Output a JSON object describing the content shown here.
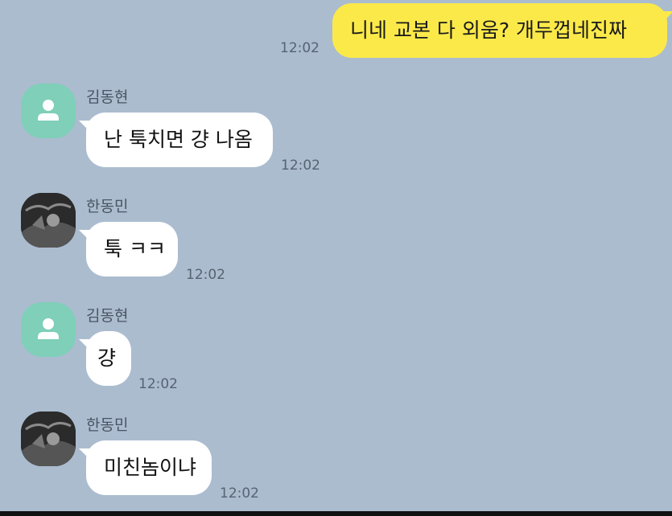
{
  "messages": [
    {
      "sender": "me",
      "text": "니네 교본 다 외움? 개두껍네진짜",
      "time": "12:02"
    },
    {
      "sender": "김동현",
      "text": "난 툭치면 걍 나옴",
      "time": "12:02"
    },
    {
      "sender": "한동민",
      "text": "툭 ㅋㅋ",
      "time": "12:02"
    },
    {
      "sender": "김동현",
      "text": "걍",
      "time": "12:02"
    },
    {
      "sender": "한동민",
      "text": "미친놈이냐",
      "time": "12:02"
    }
  ],
  "colors": {
    "background": "#abbccf",
    "my_bubble": "#fbe94a",
    "other_bubble": "#ffffff",
    "default_avatar": "#7fcfb9"
  }
}
